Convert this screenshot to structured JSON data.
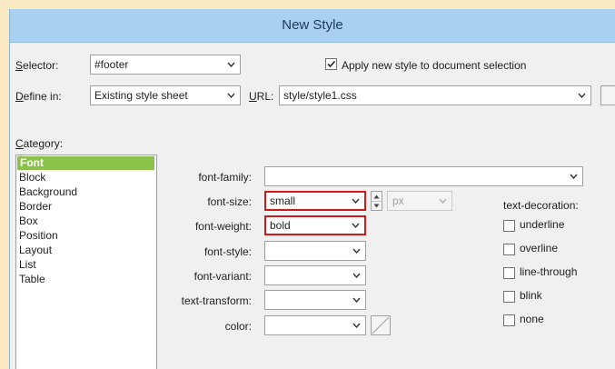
{
  "window": {
    "title": "New Style"
  },
  "selector": {
    "label": "Selector:",
    "value": "#footer"
  },
  "apply": {
    "label": "Apply new style to document selection",
    "checked": true
  },
  "define_in": {
    "label": "Define in:",
    "value": "Existing style sheet"
  },
  "url": {
    "label": "URL:",
    "value": "style/style1.css"
  },
  "category": {
    "label": "Category:",
    "items": [
      "Font",
      "Block",
      "Background",
      "Border",
      "Box",
      "Position",
      "Layout",
      "List",
      "Table"
    ],
    "selected": "Font"
  },
  "props": {
    "font_family": {
      "label": "font-family:",
      "value": ""
    },
    "font_size": {
      "label": "font-size:",
      "value": "small",
      "unit": "px"
    },
    "font_weight": {
      "label": "font-weight:",
      "value": "bold"
    },
    "font_style": {
      "label": "font-style:",
      "value": ""
    },
    "font_variant": {
      "label": "font-variant:",
      "value": ""
    },
    "text_transform": {
      "label": "text-transform:",
      "value": ""
    },
    "color": {
      "label": "color:",
      "value": ""
    }
  },
  "text_decoration": {
    "label": "text-decoration:",
    "options": [
      "underline",
      "overline",
      "line-through",
      "blink",
      "none"
    ]
  },
  "colors": {
    "titlebar": "#a9d0ef",
    "highlight": "#d01a1a",
    "selected_category": "#8bc34a"
  }
}
